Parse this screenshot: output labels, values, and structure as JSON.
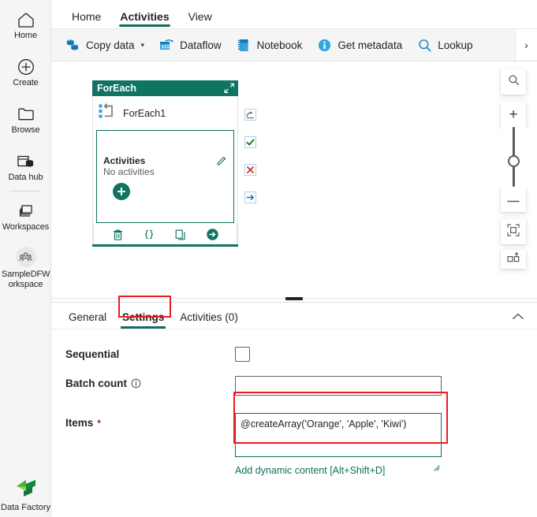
{
  "rail": {
    "items": [
      {
        "label": "Home",
        "icon": "home-icon"
      },
      {
        "label": "Create",
        "icon": "plus-circle-icon"
      },
      {
        "label": "Browse",
        "icon": "folder-icon"
      },
      {
        "label": "Data hub",
        "icon": "data-hub-icon"
      },
      {
        "label": "Workspaces",
        "icon": "workspaces-icon"
      },
      {
        "label": "SampleDFW orkspace",
        "icon": "workspace-group-icon"
      }
    ],
    "product": {
      "label": "Data Factory",
      "icon": "data-factory-logo"
    }
  },
  "ribbon": {
    "tabs": [
      {
        "label": "Home",
        "active": false
      },
      {
        "label": "Activities",
        "active": true
      },
      {
        "label": "View",
        "active": false
      }
    ],
    "commands": [
      {
        "label": "Copy data",
        "icon": "copy-data-icon",
        "has_chevron": true
      },
      {
        "label": "Dataflow",
        "icon": "dataflow-icon",
        "has_chevron": false
      },
      {
        "label": "Notebook",
        "icon": "notebook-icon",
        "has_chevron": false
      },
      {
        "label": "Get metadata",
        "icon": "get-metadata-icon",
        "has_chevron": false
      },
      {
        "label": "Lookup",
        "icon": "lookup-icon",
        "has_chevron": false
      }
    ],
    "overflow_glyph": "›"
  },
  "canvas": {
    "activity": {
      "header_title": "ForEach",
      "name": "ForEach1",
      "inner_title": "Activities",
      "inner_subtitle": "No activities",
      "expand_icon": "expand-collapse-arrows-icon",
      "type_icon": "foreach-activity-icon",
      "edit_icon": "pencil-icon",
      "add_icon": "add-activity-button",
      "actions": [
        {
          "icon": "delete-icon",
          "name": "delete-activity-button"
        },
        {
          "icon": "code-braces-icon",
          "name": "view-code-button"
        },
        {
          "icon": "copy-icon",
          "name": "clone-activity-button"
        },
        {
          "icon": "arrow-right-circle-icon",
          "name": "run-activity-button"
        }
      ],
      "status_connectors": [
        {
          "name": "on-skip-connector",
          "icon": "skip-arrow-icon"
        },
        {
          "name": "on-success-connector",
          "icon": "check-icon"
        },
        {
          "name": "on-failure-connector",
          "icon": "x-icon"
        },
        {
          "name": "on-completion-connector",
          "icon": "arrow-right-icon"
        }
      ]
    },
    "zoom_controls": [
      {
        "name": "zoom-search-button",
        "icon": "magnifier-icon"
      },
      {
        "name": "zoom-in-button",
        "icon": "plus-icon",
        "glyph": "+"
      },
      {
        "name": "zoom-slider",
        "icon": "slider-thumb"
      },
      {
        "name": "zoom-out-button",
        "icon": "minus-icon",
        "glyph": "—"
      },
      {
        "name": "fit-to-screen-button",
        "icon": "fit-to-screen-icon"
      },
      {
        "name": "auto-layout-button",
        "icon": "auto-layout-icon"
      }
    ]
  },
  "properties": {
    "tabs": [
      {
        "label": "General",
        "active": false
      },
      {
        "label": "Settings",
        "active": true
      },
      {
        "label": "Activities (0)",
        "active": false
      }
    ],
    "collapse_icon": "chevron-up-icon",
    "fields": {
      "sequential": {
        "label": "Sequential",
        "checked": false
      },
      "batch_count": {
        "label": "Batch count",
        "value": "",
        "placeholder": "",
        "info_icon": "info-icon"
      },
      "items": {
        "label": "Items",
        "required_marker": "*",
        "value": "@createArray('Orange', 'Apple', 'Kiwi')",
        "dynamic_content_link": "Add dynamic content [Alt+Shift+D]"
      }
    }
  },
  "annotations": {
    "settings_tab_highlight": {
      "color": "#ec1c24"
    },
    "items_field_highlight": {
      "color": "#ec1c24"
    }
  }
}
